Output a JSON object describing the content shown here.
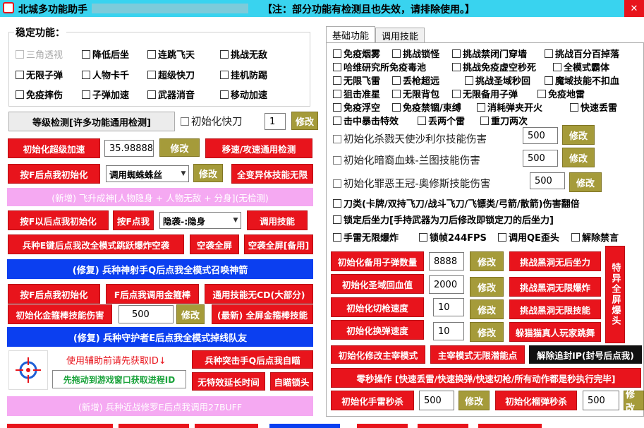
{
  "title": {
    "app_name": "北城多功能助手",
    "notice": "【注：部分功能有检测且也失效，请排除使用。】"
  },
  "colors": {
    "title_bg": "#39d3ef",
    "red": "#e8141c",
    "olive": "#a59b3a",
    "blue": "#0b3ff0",
    "pink": "#f5a9f2"
  },
  "stable": {
    "heading": "稳定功能：",
    "checkboxes": [
      {
        "label": "三角透视",
        "disabled": true
      },
      {
        "label": "降低后坐"
      },
      {
        "label": "连跳飞天"
      },
      {
        "label": "挑战无敌"
      },
      {
        "label": "无限子弹"
      },
      {
        "label": "人物卡千"
      },
      {
        "label": "超级快刀"
      },
      {
        "label": "挂机防踢"
      },
      {
        "label": "免疫摔伤"
      },
      {
        "label": "子弹加速"
      },
      {
        "label": "武器消音"
      },
      {
        "label": "移动加速"
      }
    ]
  },
  "left": {
    "level_check": "等级检测[许多功能通用检测]",
    "init_knife": "初始化快刀",
    "knife_val": "1",
    "modify": "修改",
    "init_super_speed": "初始化超级加速",
    "speed_val": "35.98888",
    "move_attack_check": "移速/攻速通用检测",
    "press_f_init": "按F后点我初始化",
    "spider_select": "调用蜘蛛蛛丝",
    "all_alien": "全变异体技能无限",
    "new_fly": "(新增) 飞升成神[人物隐身 + 人物无敌 + 分身](无检测)",
    "press_f_after_init": "按F以后点我初始化",
    "press_f_click": "按F点我",
    "stealth_select": "隐袭-:隐身",
    "call_skill": "调用技能",
    "soldier_e": "兵种E键后点我改全模式跳跃爆炸空袭",
    "airstrike_full": "空袭全屏",
    "airstrike_full_backup": "空袭全屏[备用]",
    "fix_sniper": "(修复) 兵种神射手Q后点我全模式召唤神箭",
    "press_f_init2": "按F后点我初始化",
    "f_call_gold": "F后点我调用金箍棒",
    "skill_no_cd": "通用技能无CD(大部分)",
    "init_gold_damage": "初始化金箍棒技能伤害",
    "gold_val": "500",
    "latest_gold": "(最新) 全屏金箍棒技能",
    "fix_guardian": "(修复) 兵种守护者E后点我全模式掉线队友",
    "get_id_first": "使用辅助前请先获取ID↓",
    "drag_get_pid": "先拖动到游戏窗口获取进程ID",
    "assault_q": "兵种突击手Q后点我自瞄",
    "invalid_delay": "无特效延长时间",
    "aim_lock": "自瞄锁头",
    "new_melee": "(新增) 兵种近战修罗E后点我调用27BUFF"
  },
  "tabs": [
    "基础功能",
    "调用技能"
  ],
  "right": {
    "checkboxes_row1": [
      "免疫烟雾",
      "挑战锁怪",
      "挑战禁闭门穿墙",
      "挑战百分百掉落"
    ],
    "checkboxes_row2": [
      "哈维研究所免疫毒池",
      "挑战免疫虚空秒死",
      "全模式霸体"
    ],
    "checkboxes_row3": [
      "无限飞雷",
      "丢枪超远",
      "挑战圣域秒回",
      "魔域技能不扣血"
    ],
    "checkboxes_row4": [
      "狙击准星",
      "无限背包",
      "无限备用子弹",
      "免疫地雷"
    ],
    "checkboxes_row5": [
      "免疫浮空",
      "免疫禁锢/束缚",
      "消耗弹夹开火",
      "快速丢雷"
    ],
    "checkboxes_row6": [
      "击中暴击特效",
      "丢两个雷",
      "重刀两次"
    ],
    "init_shakur": "初始化杀戮天使沙利尔技能伤害",
    "init_lantu": "初始化暗裔血蛛-兰图技能伤害",
    "init_osiris": "初始化罪恶王冠-奥修斯技能伤害",
    "dmg_val": "500",
    "knife_types": "刀类(卡牌/双持飞刀/战斗飞刀/飞镖类/弓箭/散箭)伤害翻倍",
    "lock_recoil": "锁定后坐力[手持武器为刀后修改即锁定刀的后坐力]",
    "grenade_unlimited": "手雷无限爆炸",
    "lock_fps": "锁帧244FPS",
    "call_qe": "调用QE歪头",
    "unban": "解除禁言",
    "init_backup_ammo": "初始化备用子弹数量",
    "ammo_val": "8888",
    "blackhole_recoil": "挑战黑洞无后坐力",
    "init_heal": "初始化圣域回血值",
    "heal_val": "2000",
    "blackhole_explode": "挑战黑洞无限爆炸",
    "init_knife_speed": "初始化切枪速度",
    "knife_speed_val": "10",
    "blackhole_skill": "挑战黑洞无限技能",
    "init_switch_speed": "初始化换弹速度",
    "switch_val": "10",
    "cat_real": "躲猫猫真人玩家跳舞",
    "special_fullscreen": "特异全屏爆头",
    "init_master": "初始化修改主宰模式",
    "master_unlimited": "主宰模式无限潜能点",
    "unblock_ip": "解除追封IP(封号后点我)",
    "zero_sec": "零秒操作 [快速丢雷/快速换弹/快速切枪/所有动作都是秒执行完毕]",
    "init_grenade_kill": "初始化手雷秒杀",
    "grenade_val": "500",
    "init_launcher_kill": "初始化榴弹秒杀",
    "launcher_val": "500",
    "modify_short": "修改"
  }
}
